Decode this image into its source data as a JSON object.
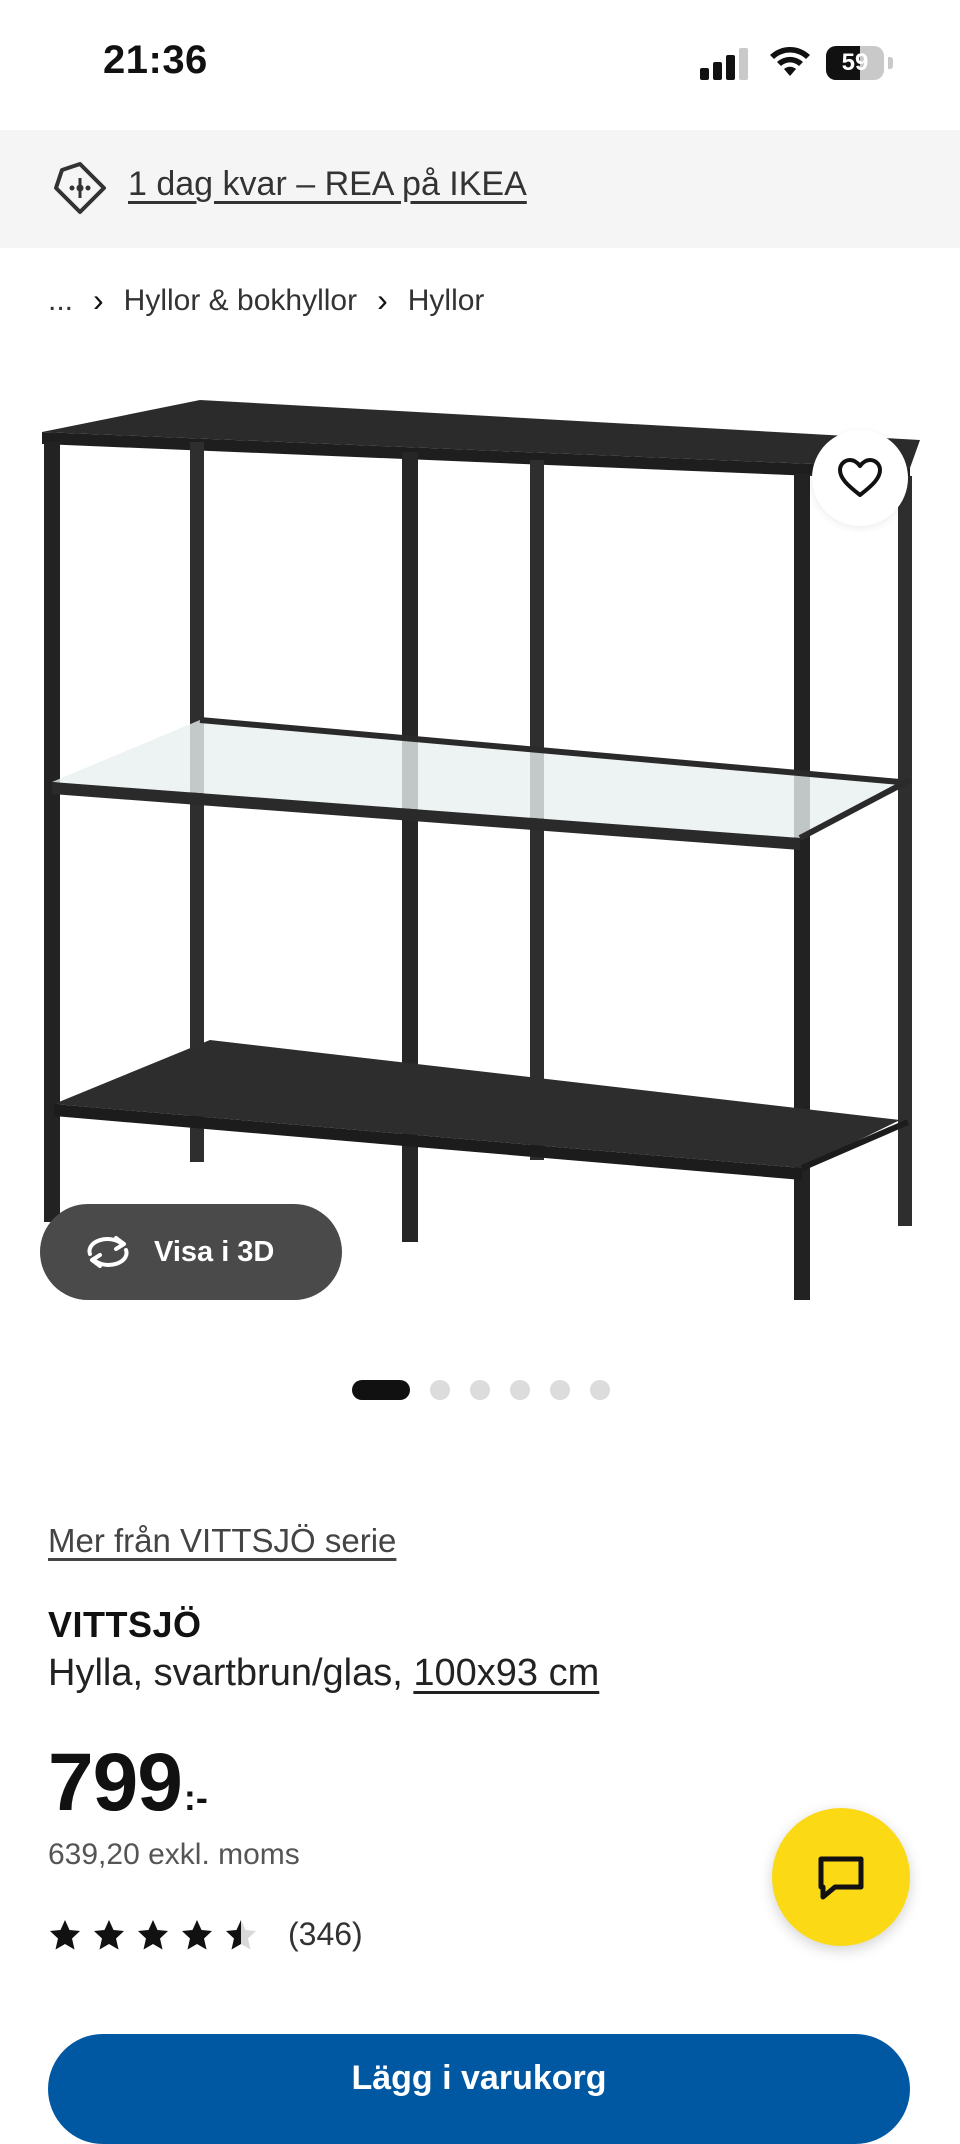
{
  "status_bar": {
    "time": "21:36",
    "battery_level": "59",
    "battery_fraction": 0.59,
    "signal_icon": "cellular-signal-icon",
    "wifi_icon": "wifi-icon"
  },
  "promo": {
    "icon": "price-tag-icon",
    "text": "1 dag kvar – REA på IKEA"
  },
  "breadcrumb": {
    "items": [
      "...",
      "Hyllor & bokhyllor",
      "Hyllor"
    ],
    "separator": "›"
  },
  "media": {
    "favorite_icon": "heart-icon",
    "view_3d_label": "Visa i 3D",
    "view_3d_icon": "rotate-icon",
    "image_count": 6,
    "active_index": 0
  },
  "product": {
    "series_link": "Mer från VITTSJÖ serie",
    "name": "VITTSJÖ",
    "description": "Hylla, svartbrun/glas,",
    "size": "100x93 cm",
    "price": "799",
    "price_suffix": ":-",
    "price_excl_vat": "639,20 exkl. moms",
    "rating": 4.5,
    "review_count": "(346)"
  },
  "chat": {
    "icon": "chat-icon"
  },
  "buy_button": {
    "label": "Lägg i varukorg"
  },
  "colors": {
    "accent_blue": "#0058a3",
    "chat_yellow": "#fbd914",
    "banner_gray": "#f5f5f5",
    "button_dark": "#4a4a4a"
  }
}
